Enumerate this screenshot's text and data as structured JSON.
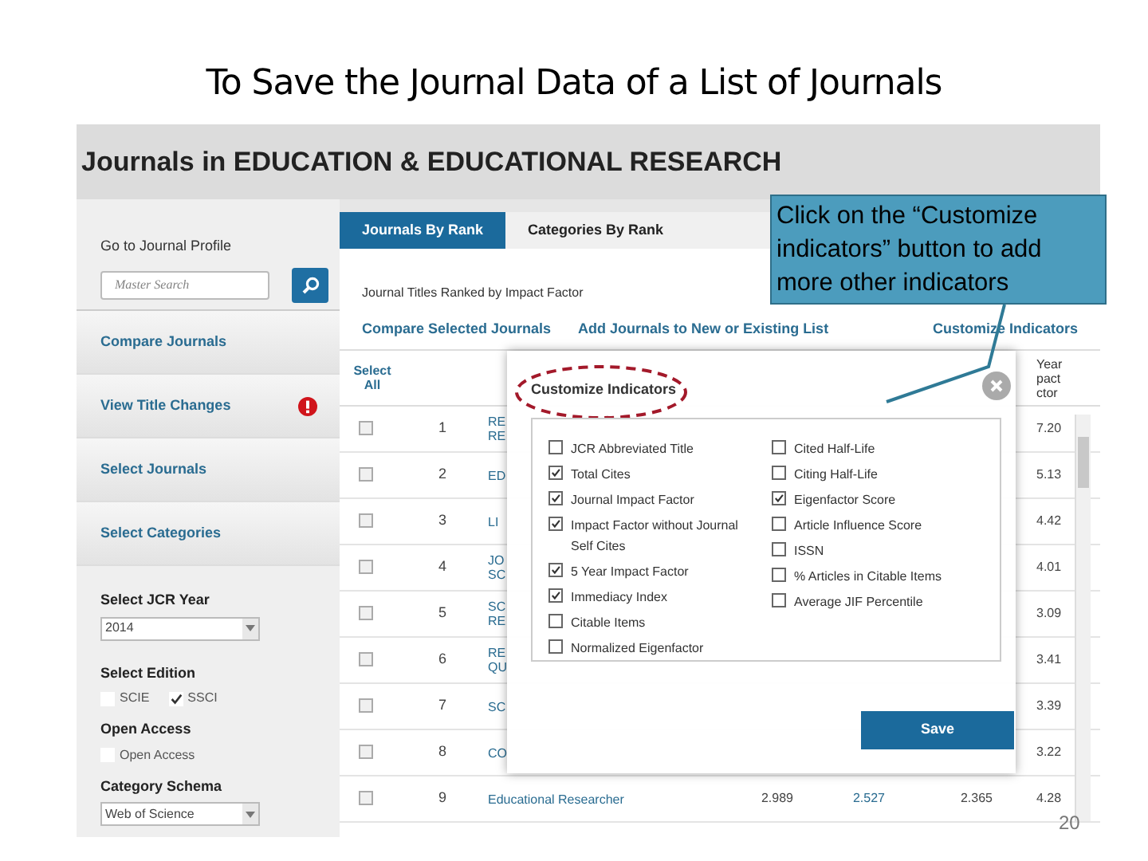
{
  "slide_title": "To Save the Journal Data of a List of Journals",
  "page_header": "Journals in EDUCATION & EDUCATIONAL RESEARCH",
  "sidebar": {
    "profile_label": "Go to Journal Profile",
    "search": {
      "placeholder": "Master Search"
    },
    "links": [
      {
        "label": "Compare Journals",
        "alert": false
      },
      {
        "label": "View Title Changes",
        "alert": true
      },
      {
        "label": "Select Journals",
        "alert": false
      },
      {
        "label": "Select Categories",
        "alert": false
      }
    ],
    "year": {
      "label": "Select JCR Year",
      "value": "2014"
    },
    "edition": {
      "label": "Select Edition",
      "options": [
        {
          "label": "SCIE",
          "checked": false
        },
        {
          "label": "SSCI",
          "checked": true
        }
      ]
    },
    "open_access": {
      "label": "Open Access",
      "options": [
        {
          "label": "Open Access",
          "checked": false
        }
      ]
    },
    "schema": {
      "label": "Category Schema",
      "value": "Web of Science"
    }
  },
  "tabs": [
    {
      "label": "Journals By Rank",
      "selected": true
    },
    {
      "label": "Categories By Rank",
      "selected": false
    }
  ],
  "subtitle": "Journal Titles Ranked by Impact Factor",
  "actions": [
    "Compare Selected Journals",
    "Add Journals to New or Existing List"
  ],
  "customize_link": "Customize Indicators",
  "table": {
    "select_all": "Select All",
    "last_column_header": [
      "Year",
      "pact",
      "ctor"
    ],
    "rows": [
      {
        "checked": false,
        "rank": "1",
        "title": [
          "RE",
          "RE"
        ],
        "last_value": "7.20"
      },
      {
        "checked": false,
        "rank": "2",
        "title": [
          "ED"
        ],
        "last_value": "5.13"
      },
      {
        "checked": false,
        "rank": "3",
        "title": [
          "LI"
        ],
        "last_value": "4.42"
      },
      {
        "checked": false,
        "rank": "4",
        "title": [
          "JO",
          "SC"
        ],
        "last_value": "4.01"
      },
      {
        "checked": false,
        "rank": "5",
        "title": [
          "SC",
          "RE"
        ],
        "last_value": "3.09"
      },
      {
        "checked": false,
        "rank": "6",
        "title": [
          "RE",
          "QU"
        ],
        "last_value": "3.41"
      },
      {
        "checked": false,
        "rank": "7",
        "title": [
          "SC"
        ],
        "last_value": "3.39"
      },
      {
        "checked": false,
        "rank": "8",
        "title": [
          "CO"
        ],
        "last_value": "3.22"
      },
      {
        "checked": false,
        "rank": "9",
        "title": [
          "Educational Researcher"
        ],
        "middle_values": [
          "2.989",
          "2.527",
          "2.365"
        ],
        "last_value": "4.28"
      }
    ]
  },
  "modal": {
    "title": "Customize Indicators",
    "columns": [
      [
        {
          "label": "JCR Abbreviated Title",
          "checked": false
        },
        {
          "label": "Total Cites",
          "checked": true
        },
        {
          "label": "Journal Impact Factor",
          "checked": true
        },
        {
          "label": "Impact Factor without Journal Self Cites",
          "checked": true
        },
        {
          "label": "5 Year Impact Factor",
          "checked": true
        },
        {
          "label": "Immediacy Index",
          "checked": true
        },
        {
          "label": "Citable Items",
          "checked": false
        },
        {
          "label": "Normalized Eigenfactor",
          "checked": false
        }
      ],
      [
        {
          "label": "Cited Half-Life",
          "checked": false
        },
        {
          "label": "Citing Half-Life",
          "checked": false
        },
        {
          "label": "Eigenfactor Score",
          "checked": true
        },
        {
          "label": "Article Influence Score",
          "checked": false
        },
        {
          "label": "ISSN",
          "checked": false
        },
        {
          "label": "% Articles in Citable Items",
          "checked": false
        },
        {
          "label": "Average JIF Percentile",
          "checked": false
        }
      ]
    ],
    "save_button": "Save"
  },
  "callout": "Click on the “Customize indicators” button to add more other indicators",
  "page_number": "20"
}
